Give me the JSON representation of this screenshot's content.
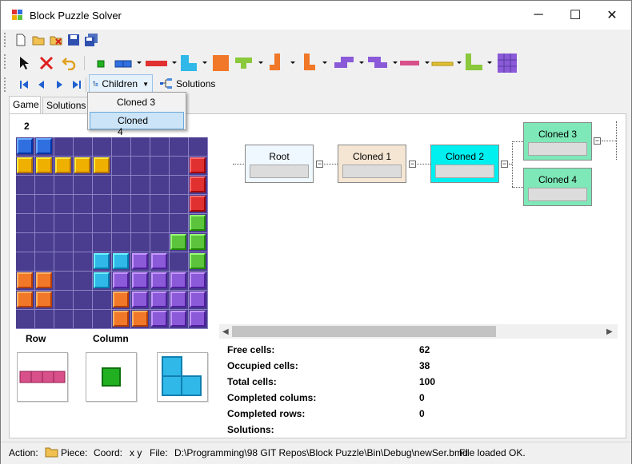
{
  "window": {
    "title": "Block Puzzle Solver",
    "minimize": "─",
    "maximize": "☐",
    "close": "✕"
  },
  "toolbar_file": {
    "icons": [
      "new-file-icon",
      "open-folder-icon",
      "close-file-icon",
      "save-icon",
      "save-all-icon"
    ]
  },
  "toolbar_pieces": {
    "icons": [
      "pointer-icon",
      "delete-icon",
      "undo-icon"
    ]
  },
  "nav": {
    "children_label": "Children",
    "solutions_label": "Solutions",
    "menu_items": [
      "Cloned 3",
      "Cloned 4"
    ]
  },
  "tabs": [
    "Game",
    "Solutions"
  ],
  "level": "2",
  "board": {
    "rows": 10,
    "cols": 10,
    "colors": {
      "B": "#2f6fe0",
      "Y": "#f0b000",
      "R": "#e03030",
      "G": "#5cc43c",
      "C": "#30b8e8",
      "P": "#8a5ad8",
      "O": "#f07828",
      ".": ""
    },
    "cells": [
      "BB........",
      "YYYYY....R",
      ".........R",
      ".........R",
      ".........G",
      "........GG",
      "....CCPP.G",
      "OO..CPPPPP",
      "OO...OPPPP",
      ".....OOPPP"
    ]
  },
  "preview": {
    "row_label": "Row",
    "column_label": "Column"
  },
  "tree": {
    "nodes": [
      {
        "label": "Root",
        "color": "#f0f8ff"
      },
      {
        "label": "Cloned 1",
        "color": "#f5e6d3"
      },
      {
        "label": "Cloned 2",
        "color": "#00f0f0"
      },
      {
        "label": "Cloned 3",
        "color": "#7ee8b8"
      },
      {
        "label": "Cloned 4",
        "color": "#7ee8b8"
      }
    ],
    "toggle": "−"
  },
  "stats": [
    {
      "label": "Free cells:",
      "value": "62"
    },
    {
      "label": "Occupied cells:",
      "value": "38"
    },
    {
      "label": "Total cells:",
      "value": "100"
    },
    {
      "label": "Completed colums:",
      "value": "0"
    },
    {
      "label": "Completed rows:",
      "value": "0"
    },
    {
      "label": "Solutions:",
      "value": ""
    }
  ],
  "status": {
    "action": "Action:",
    "piece": "Piece:",
    "coord": "Coord:",
    "coord_value": "x  y",
    "file_label": "File:",
    "file_path": "D:\\Programming\\98 GIT Repos\\Block Puzzle\\Bin\\Debug\\newSer.bmd",
    "message": "File loaded OK."
  }
}
